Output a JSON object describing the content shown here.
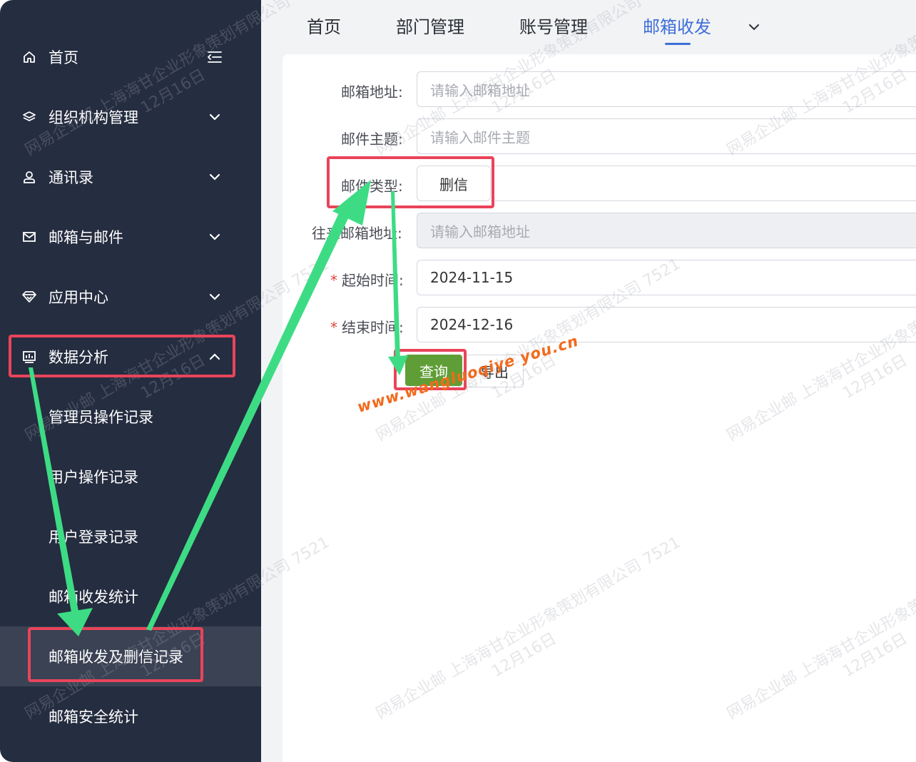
{
  "sidebar": {
    "items": [
      {
        "label": "首页",
        "icon": "home-icon"
      },
      {
        "label": "组织机构管理",
        "icon": "layers-icon"
      },
      {
        "label": "通讯录",
        "icon": "user-icon"
      },
      {
        "label": "邮箱与邮件",
        "icon": "mail-icon"
      },
      {
        "label": "应用中心",
        "icon": "diamond-icon"
      },
      {
        "label": "数据分析",
        "icon": "monitor-chart-icon"
      }
    ],
    "sub_items": [
      {
        "label": "管理员操作记录"
      },
      {
        "label": "用户操作记录"
      },
      {
        "label": "用户登录记录"
      },
      {
        "label": "邮箱收发统计"
      },
      {
        "label": "邮箱收发及删信记录",
        "active": true
      },
      {
        "label": "邮箱安全统计"
      }
    ]
  },
  "tabs": [
    {
      "label": "首页"
    },
    {
      "label": "部门管理"
    },
    {
      "label": "账号管理"
    },
    {
      "label": "邮箱收发",
      "active": true
    }
  ],
  "form": {
    "email_address": {
      "label": "邮箱地址:",
      "placeholder": "请输入邮箱地址"
    },
    "subject": {
      "label": "邮件主题:",
      "placeholder": "请输入邮件主题"
    },
    "mail_type": {
      "label": "邮件类型:",
      "value": "删信"
    },
    "peer_address": {
      "label": "往来邮箱地址:",
      "placeholder": "请输入邮箱地址"
    },
    "start_time": {
      "label": "起始时间:",
      "value": "2024-11-15",
      "required_mark": "*"
    },
    "end_time": {
      "label": "结束时间:",
      "value": "2024-12-16",
      "required_mark": "*"
    },
    "query_label": "查询",
    "export_label": "导出"
  },
  "watermark": {
    "line1": "网易企业邮 上海海甘企业形象策划有限公司 7521",
    "line2": "12月16日"
  },
  "site_watermark": "www.wangluoqiye you.cn",
  "colors": {
    "sidebar_bg": "#252d40",
    "active_tab": "#3e6fd8",
    "query_button": "#5f9e36",
    "highlight_box": "#e9445a",
    "arrow": "#3ddc84"
  }
}
